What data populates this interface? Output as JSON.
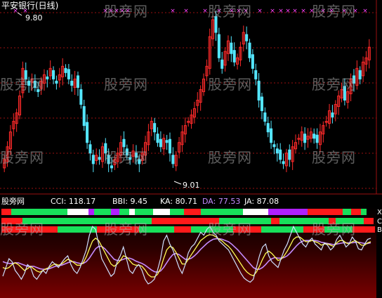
{
  "title": "平安银行(日线)",
  "watermark": "股旁网",
  "main_panel": {
    "high_label": "9.80",
    "low_label": "9.01"
  },
  "indicator_panel": {
    "name": "股旁网",
    "readouts": [
      {
        "label": "CCI:",
        "value": "118.17",
        "color": "#ffffff"
      },
      {
        "label": "BBI:",
        "value": "9.45",
        "color": "#ffffff"
      },
      {
        "label": "KA:",
        "value": "80.71",
        "color": "#ffffff"
      },
      {
        "label": "DA:",
        "value": "77.53",
        "color": "#c58cff"
      },
      {
        "label": "JA:",
        "value": "87.08",
        "color": "#ffffff"
      }
    ],
    "bar_labels": [
      "X",
      "C",
      "B"
    ]
  },
  "colors": {
    "up": "#ff2a2a",
    "down": "#54e6ff",
    "grid": "#9a1010",
    "signal_marker": "#ff44ff",
    "cci_line": "#cfe0ff",
    "ka_line": "#ffff55",
    "da_line": "#c58cff"
  },
  "chart_data": {
    "type": "candlestick",
    "price_high": 9.8,
    "price_low": 9.01,
    "close": [
      9.12,
      9.18,
      9.25,
      9.3,
      9.34,
      9.42,
      9.55,
      9.5,
      9.47,
      9.5,
      9.46,
      9.44,
      9.49,
      9.52,
      9.5,
      9.55,
      9.5,
      9.48,
      9.52,
      9.56,
      9.53,
      9.5,
      9.47,
      9.5,
      9.46,
      9.38,
      9.28,
      9.2,
      9.15,
      9.1,
      9.14,
      9.12,
      9.18,
      9.15,
      9.1,
      9.08,
      9.12,
      9.15,
      9.2,
      9.18,
      9.14,
      9.12,
      9.16,
      9.13,
      9.1,
      9.15,
      9.2,
      9.25,
      9.3,
      9.25,
      9.2,
      9.18,
      9.22,
      9.2,
      9.15,
      9.1,
      9.14,
      9.2,
      9.25,
      9.28,
      9.3,
      9.33,
      9.36,
      9.4,
      9.45,
      9.5,
      9.56,
      9.7,
      9.78,
      9.72,
      9.6,
      9.55,
      9.63,
      9.68,
      9.62,
      9.58,
      9.6,
      9.65,
      9.72,
      9.68,
      9.6,
      9.55,
      9.5,
      9.4,
      9.35,
      9.3,
      9.25,
      9.2,
      9.18,
      9.15,
      9.12,
      9.1,
      9.15,
      9.12,
      9.18,
      9.2,
      9.22,
      9.25,
      9.2,
      9.23,
      9.25,
      9.22,
      9.2,
      9.25,
      9.28,
      9.3,
      9.35,
      9.32,
      9.38,
      9.42,
      9.45,
      9.4,
      9.44,
      9.5,
      9.48,
      9.55,
      9.5,
      9.58,
      9.6,
      9.65
    ],
    "kd": {
      "cci": [
        25,
        40,
        55,
        50,
        35,
        28,
        20,
        30,
        45,
        40,
        25,
        20,
        28,
        35,
        30,
        42,
        50,
        45,
        40,
        48,
        55,
        60,
        45,
        35,
        30,
        40,
        55,
        70,
        95,
        110,
        105,
        80,
        55,
        45,
        35,
        25,
        30,
        50,
        60,
        75,
        55,
        35,
        30,
        40,
        45,
        35,
        20,
        12,
        15,
        20,
        35,
        55,
        85,
        95,
        80,
        70,
        55,
        40,
        30,
        45,
        65,
        75,
        80,
        90,
        100,
        95,
        105,
        110,
        100,
        95,
        85,
        80,
        75,
        70,
        60,
        50,
        40,
        30,
        22,
        18,
        15,
        20,
        40,
        60,
        75,
        80,
        60,
        50,
        45,
        40,
        55,
        70,
        80,
        95,
        110,
        100,
        90,
        80,
        75,
        85,
        90,
        80,
        75,
        70,
        82,
        78,
        70,
        75,
        88,
        95,
        85,
        75,
        80,
        92,
        85,
        72,
        70,
        80,
        88,
        90
      ],
      "ka": [
        40,
        38,
        40,
        45,
        48,
        45,
        40,
        35,
        38,
        42,
        38,
        34,
        32,
        35,
        38,
        40,
        44,
        46,
        44,
        46,
        50,
        54,
        52,
        48,
        44,
        44,
        48,
        58,
        72,
        85,
        90,
        86,
        76,
        66,
        56,
        46,
        42,
        46,
        52,
        60,
        58,
        52,
        46,
        44,
        44,
        42,
        36,
        28,
        24,
        24,
        28,
        38,
        55,
        70,
        76,
        74,
        66,
        56,
        46,
        46,
        54,
        62,
        70,
        78,
        86,
        90,
        94,
        96,
        95,
        92,
        88,
        85,
        80,
        76,
        70,
        62,
        54,
        46,
        38,
        32,
        28,
        26,
        32,
        42,
        54,
        64,
        68,
        64,
        58,
        52,
        54,
        60,
        68,
        78,
        88,
        92,
        92,
        88,
        84,
        84,
        86,
        84,
        82,
        78,
        80,
        80,
        78,
        76,
        82,
        86,
        86,
        82,
        80,
        84,
        86,
        82,
        78,
        78,
        82,
        84
      ],
      "da": [
        50,
        48,
        47,
        47,
        48,
        48,
        46,
        44,
        42,
        42,
        42,
        40,
        38,
        37,
        37,
        38,
        40,
        42,
        43,
        44,
        46,
        48,
        50,
        50,
        48,
        47,
        47,
        50,
        56,
        64,
        72,
        76,
        76,
        72,
        66,
        60,
        54,
        52,
        52,
        54,
        56,
        56,
        54,
        51,
        49,
        47,
        44,
        40,
        36,
        33,
        32,
        34,
        40,
        48,
        56,
        62,
        64,
        62,
        58,
        54,
        54,
        56,
        60,
        65,
        71,
        76,
        81,
        85,
        88,
        89,
        89,
        88,
        86,
        84,
        80,
        75,
        70,
        64,
        58,
        52,
        46,
        40,
        37,
        37,
        40,
        45,
        51,
        55,
        57,
        56,
        56,
        57,
        60,
        65,
        71,
        77,
        82,
        85,
        86,
        86,
        86,
        86,
        85,
        83,
        82,
        81,
        80,
        79,
        80,
        81,
        82,
        82,
        82,
        82,
        83,
        83,
        82,
        81,
        81,
        82
      ]
    }
  }
}
